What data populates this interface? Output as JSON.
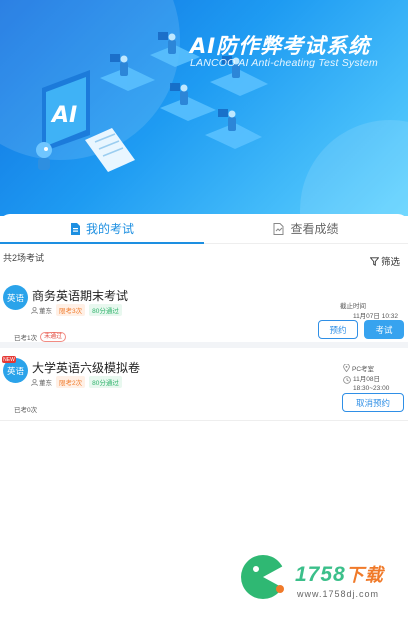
{
  "banner": {
    "title": "AI防作弊考试系统",
    "subtitle": "LANCOO AI Anti-cheating Test System",
    "art_text": "AI"
  },
  "tabs": [
    {
      "label": "我的考试",
      "icon": "exam-doc-icon",
      "active": true
    },
    {
      "label": "查看成绩",
      "icon": "score-doc-icon",
      "active": false
    }
  ],
  "summary": {
    "text": "共2场考试"
  },
  "filter": {
    "label": "筛选",
    "icon": "filter-icon"
  },
  "exams": [
    {
      "subject": "英语",
      "name": "商务英语期末考试",
      "teacher": "董东",
      "tag_attempts": "限考3次",
      "tag_pass": "80分通过",
      "attempt_text": "已考1次",
      "status_badge": "未通过",
      "deadline_label": "截止时间",
      "deadline_value": "11月07日 10:32",
      "btn_reserve": "预约",
      "btn_exam": "考试",
      "is_new": false
    },
    {
      "subject": "英语",
      "name": "大学英语六级模拟卷",
      "teacher": "董东",
      "tag_attempts": "限考2次",
      "tag_pass": "80分通过",
      "attempt_text": "已考0次",
      "location": "PC考室",
      "date": "11月08日",
      "time": "18:30~23:00",
      "btn_cancel": "取消预约",
      "is_new": true,
      "new_label": "NEW"
    }
  ],
  "watermark": {
    "brand": "1758",
    "suffix": "下载",
    "url": "www.1758dj.com"
  },
  "colors": {
    "primary": "#1d8fe1",
    "banner_start": "#0f6fe0",
    "banner_end": "#5fd3ff",
    "fail": "#e0483d",
    "tag_orange": "#f07a2a",
    "tag_green": "#2fb36b"
  }
}
